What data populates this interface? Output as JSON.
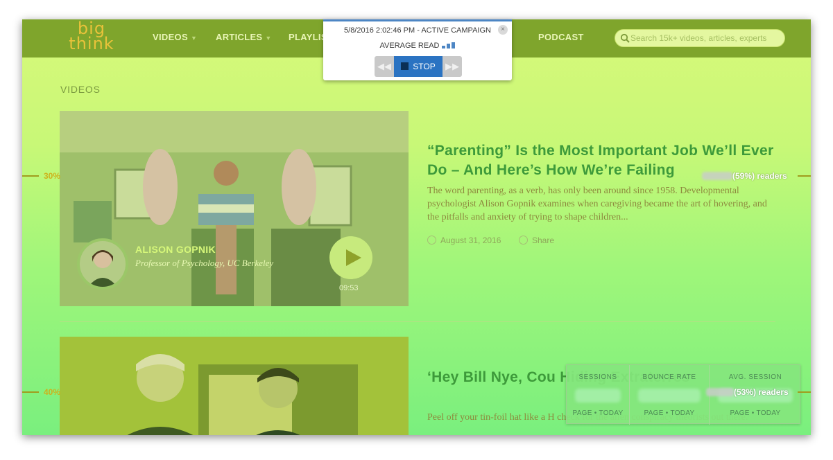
{
  "nav": {
    "logo_top": "big",
    "logo_bottom": "think",
    "items": [
      {
        "label": "VIDEOS",
        "has_caret": true
      },
      {
        "label": "ARTICLES",
        "has_caret": true
      },
      {
        "label": "PLAYLIS",
        "has_caret": false
      },
      {
        "label": "PODCAST",
        "has_caret": false
      }
    ],
    "caret": "▼",
    "search_placeholder": "Search 15k+ videos, articles, experts"
  },
  "section_title": "VIDEOS",
  "articles": [
    {
      "title": "“Parenting” Is the Most Important Job We’ll Ever Do – And Here’s How We’re Failing",
      "excerpt": "The word parenting, as a verb, has only been around since 1958. Developmental psychologist Alison Gopnik examines when caregiving became the art of hovering, and the pitfalls and anxiety of trying to shape children...",
      "date": "August 31, 2016",
      "share_label": "Share",
      "speaker_name": "ALISON GOPNIK",
      "speaker_title": "Professor of Psychology, UC Berkeley",
      "duration": "09:53"
    },
    {
      "title": "‘Hey Bill Nye, Cou Hiding Extraterres",
      "excerpt": "Peel off your tin-foil hat like a H check for the alien conspiracy theorists out there."
    }
  ],
  "scroll_depth": [
    {
      "percent": "30%",
      "readers": "(59%) readers"
    },
    {
      "percent": "40%",
      "readers": "(53%) readers"
    }
  ],
  "stats": [
    {
      "label": "SESSIONS",
      "sub": "PAGE • TODAY"
    },
    {
      "label": "BOUNCE RATE",
      "sub": "PAGE • TODAY"
    },
    {
      "label": "AVG. SESSION",
      "sub": "PAGE • TODAY"
    }
  ],
  "popup": {
    "line1": "5/8/2016 2:02:46 PM - ACTIVE CAMPAIGN",
    "line2": "AVERAGE READ",
    "close": "×",
    "stop_label": "STOP",
    "prev_icon": "◀◀",
    "next_icon": "▶▶"
  },
  "colors": {
    "accent": "#3d9a3a",
    "nav_bg": "#7fa52c",
    "popup_accent": "#2b73c2",
    "depth_marker": "#cdb21c"
  }
}
